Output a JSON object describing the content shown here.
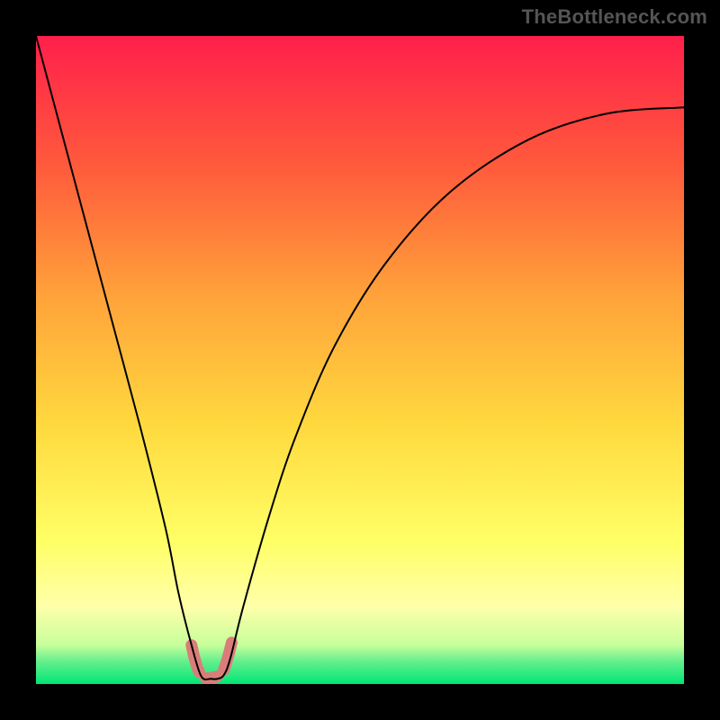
{
  "watermark": "TheBottleneck.com",
  "chart_data": {
    "type": "line",
    "title": "",
    "xlabel": "",
    "ylabel": "",
    "xlim": [
      0,
      100
    ],
    "ylim": [
      0,
      100
    ],
    "grid": false,
    "legend": false,
    "background_gradient_stops": [
      {
        "offset": 0.0,
        "color": "#ff1f4b"
      },
      {
        "offset": 0.2,
        "color": "#ff5a3c"
      },
      {
        "offset": 0.4,
        "color": "#ffa23a"
      },
      {
        "offset": 0.6,
        "color": "#ffd93e"
      },
      {
        "offset": 0.78,
        "color": "#ffff66"
      },
      {
        "offset": 0.88,
        "color": "#ffffaa"
      },
      {
        "offset": 0.94,
        "color": "#c6ff9a"
      },
      {
        "offset": 0.965,
        "color": "#65ef8e"
      },
      {
        "offset": 1.0,
        "color": "#00e676"
      }
    ],
    "series": [
      {
        "name": "bottleneck-curve",
        "x": [
          0,
          4,
          8,
          12,
          16,
          20,
          22,
          24,
          25.5,
          27,
          28,
          29,
          30,
          32,
          36,
          40,
          46,
          54,
          64,
          76,
          88,
          100
        ],
        "values": [
          100,
          85,
          70,
          55,
          40,
          24,
          14,
          6,
          1.2,
          0.8,
          0.8,
          1.4,
          4,
          12,
          26,
          38,
          52,
          65,
          76,
          84,
          88,
          89
        ],
        "color": "#000000",
        "stroke_width": 2
      },
      {
        "name": "marker-left",
        "type": "marker-strip",
        "x": [
          24.0,
          24.4,
          24.8,
          25.2
        ],
        "values": [
          6.0,
          4.2,
          2.8,
          1.8
        ],
        "color": "#da7d7a",
        "stroke_width": 13
      },
      {
        "name": "marker-bottom",
        "type": "marker-strip",
        "x": [
          26.2,
          26.8,
          27.4,
          28.0
        ],
        "values": [
          0.9,
          0.9,
          1.0,
          1.2
        ],
        "color": "#da7d7a",
        "stroke_width": 13
      },
      {
        "name": "marker-right",
        "type": "marker-strip",
        "x": [
          29.0,
          29.4,
          29.8,
          30.2
        ],
        "values": [
          2.2,
          3.4,
          4.8,
          6.4
        ],
        "color": "#da7d7a",
        "stroke_width": 13
      }
    ],
    "annotations": []
  }
}
